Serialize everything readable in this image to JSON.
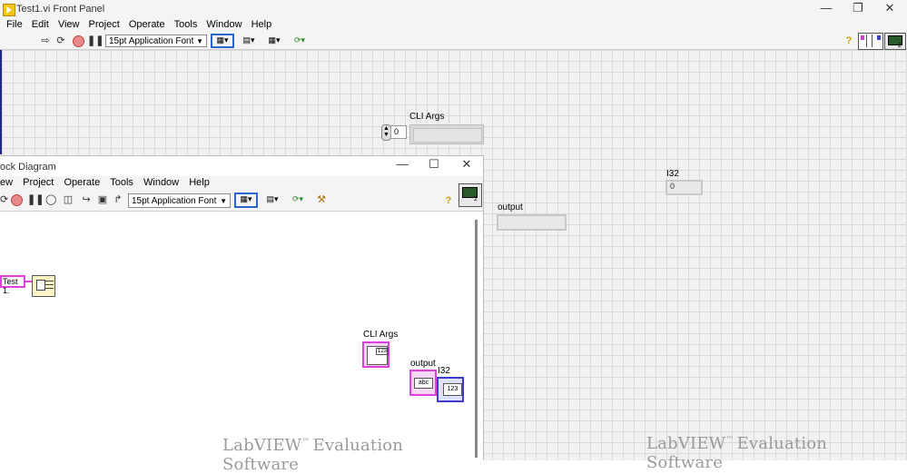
{
  "front_panel": {
    "title": "Test1.vi Front Panel",
    "menu": [
      "File",
      "Edit",
      "View",
      "Project",
      "Operate",
      "Tools",
      "Window",
      "Help"
    ],
    "font_select": "15pt Application Font",
    "controls": {
      "cli_args_label": "CLI Args",
      "cli_args_index": "0",
      "i32_label": "I32",
      "i32_value": "0",
      "output_label": "output"
    },
    "watermark": "LabVIEW",
    "watermark_tm": "™",
    "watermark_rest": "Evaluation Software"
  },
  "block_diagram": {
    "title": "ock Diagram",
    "menu": [
      "ew",
      "Project",
      "Operate",
      "Tools",
      "Window",
      "Help"
    ],
    "font_select": "15pt Application Font",
    "nodes": {
      "test_ref_label": "Test 1.",
      "cli_args_label": "CLI Args",
      "cli_args_terminal": "123",
      "output_label": "output",
      "output_terminal": "abc",
      "i32_label": "I32",
      "i32_terminal": "123"
    },
    "watermark": "LabVIEW",
    "watermark_tm": "™",
    "watermark_rest": "Evaluation Software"
  },
  "colors": {
    "string_wire": "#e040e0",
    "numeric_wire": "#3b3bd0",
    "selection": "#2b66c8"
  }
}
